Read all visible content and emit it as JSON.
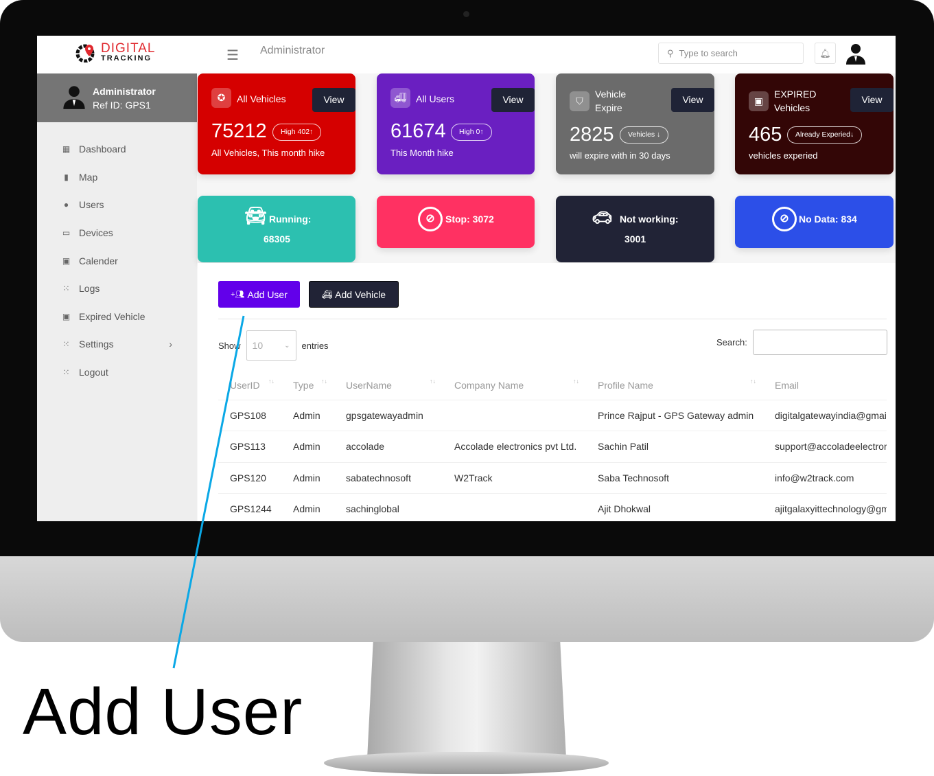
{
  "header": {
    "logo_top": "DIGITAL",
    "logo_bottom": "TRACKING",
    "title": "Administrator",
    "search_placeholder": "Type to search"
  },
  "sidebar": {
    "user_name": "Administrator",
    "ref_id": "Ref ID: GPS1",
    "items": [
      {
        "label": "Dashboard",
        "icon": "dashboard-icon"
      },
      {
        "label": "Map",
        "icon": "map-icon"
      },
      {
        "label": "Users",
        "icon": "user-circle-icon"
      },
      {
        "label": "Devices",
        "icon": "monitor-icon"
      },
      {
        "label": "Calender",
        "icon": "calendar-icon"
      },
      {
        "label": "Logs",
        "icon": "grid-icon"
      },
      {
        "label": "Expired Vehicle",
        "icon": "calendar-icon"
      },
      {
        "label": "Settings",
        "icon": "grid-icon"
      },
      {
        "label": "Logout",
        "icon": "grid-icon"
      }
    ]
  },
  "cards": [
    {
      "title": "All Vehicles",
      "view": "View",
      "value": "75212",
      "pill": "High  402↑",
      "sub": "All Vehicles, This month hike",
      "color": "#d50000"
    },
    {
      "title": "All Users",
      "view": "View",
      "value": "61674",
      "pill": "High  0↑",
      "sub": "This Month hike",
      "color": "#6a1fc1"
    },
    {
      "title": "Vehicle Expire",
      "view": "View",
      "value": "2825",
      "pill": "Vehicles  ↓",
      "sub": "will expire with in 30 days",
      "color": "#6b6b6b"
    },
    {
      "title": "EXPIRED Vehicles",
      "view": "View",
      "value": "465",
      "pill": "Already  Experied↓",
      "sub": "vehicles experied",
      "color": "#330606"
    }
  ],
  "stats": [
    {
      "label": "Running:",
      "value": "68305",
      "color": "#2cc0b0"
    },
    {
      "label": "Stop: 3072",
      "color": "#ff3162"
    },
    {
      "label": "Not working:",
      "value": "3001",
      "color": "#212336"
    },
    {
      "label": "No Data: 834",
      "color": "#2c4fe8"
    }
  ],
  "actions": {
    "add_user": "Add User",
    "add_vehicle": "Add Vehicle"
  },
  "table_controls": {
    "show": "Show",
    "entries_value": "10",
    "entries": "entries",
    "search": "Search:"
  },
  "table": {
    "columns": [
      "UserID",
      "Type",
      "UserName",
      "Company Name",
      "Profile Name",
      "Email"
    ],
    "rows": [
      [
        "GPS108",
        "Admin",
        "gpsgatewayadmin",
        "",
        "Prince Rajput - GPS Gateway admin",
        "digitalgatewayindia@gmai"
      ],
      [
        "GPS113",
        "Admin",
        "accolade",
        "Accolade electronics pvt Ltd.",
        "Sachin Patil",
        "support@accoladeelectror"
      ],
      [
        "GPS120",
        "Admin",
        "sabatechnosoft",
        "W2Track",
        "Saba Technosoft",
        "info@w2track.com"
      ],
      [
        "GPS1244",
        "Admin",
        "sachinglobal",
        "",
        "Ajit Dhokwal",
        "ajitgalaxyittechnology@gm"
      ]
    ]
  },
  "caption": "Add User",
  "pointer_color": "#0aa8e6"
}
